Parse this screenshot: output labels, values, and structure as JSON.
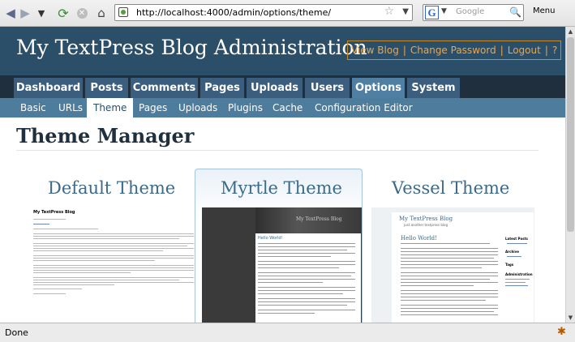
{
  "browser": {
    "url": "http://localhost:4000/admin/options/theme/",
    "search_placeholder": "Google",
    "search_engine_letter": "G",
    "menu_label": "Menu",
    "status": "Done"
  },
  "header": {
    "title": "My TextPress Blog Administration",
    "links": [
      "View Blog",
      "Change Password",
      "Logout",
      "?"
    ]
  },
  "main_nav": [
    {
      "label": "Dashboard",
      "active": false
    },
    {
      "label": "Posts",
      "active": false
    },
    {
      "label": "Comments",
      "active": false
    },
    {
      "label": "Pages",
      "active": false
    },
    {
      "label": "Uploads",
      "active": false
    },
    {
      "label": "Users",
      "active": false
    },
    {
      "label": "Options",
      "active": true
    },
    {
      "label": "System",
      "active": false
    }
  ],
  "sub_nav": [
    {
      "label": "Basic",
      "active": false
    },
    {
      "label": "URLs",
      "active": false
    },
    {
      "label": "Theme",
      "active": true
    },
    {
      "label": "Pages",
      "active": false
    },
    {
      "label": "Uploads",
      "active": false
    },
    {
      "label": "Plugins",
      "active": false
    },
    {
      "label": "Cache",
      "active": false
    },
    {
      "label": "Configuration Editor",
      "active": false
    }
  ],
  "page_title": "Theme Manager",
  "themes": [
    {
      "name": "Default Theme",
      "preview_title": "My TextPress Blog"
    },
    {
      "name": "Myrtle Theme",
      "preview_title": "My TextPress Blog",
      "preview_post": "Hello World!"
    },
    {
      "name": "Vessel Theme",
      "preview_title": "My TextPress Blog",
      "preview_subtitle": "just another textpress blog",
      "preview_post": "Hello World!",
      "preview_sidebar": [
        "Latest Posts",
        "Archive",
        "Tags",
        "Administration"
      ]
    }
  ]
}
